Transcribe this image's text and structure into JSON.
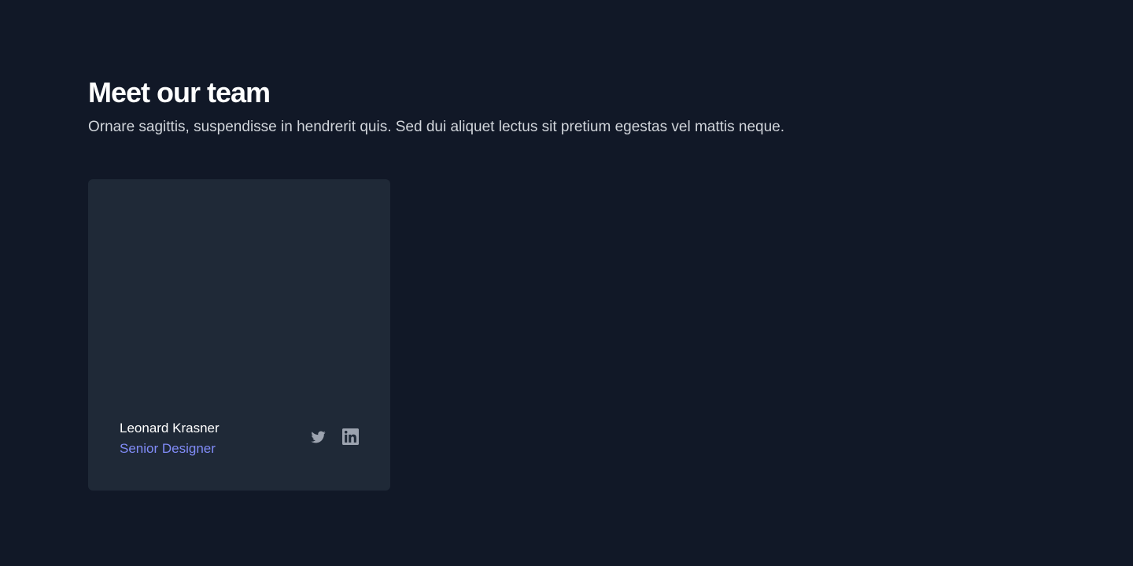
{
  "section": {
    "title": "Meet our team",
    "subtitle": "Ornare sagittis, suspendisse in hendrerit quis. Sed dui aliquet lectus sit pretium egestas vel mattis neque."
  },
  "team": [
    {
      "name": "Leonard Krasner",
      "role": "Senior Designer",
      "socials": [
        "twitter-icon",
        "linkedin-icon"
      ]
    }
  ],
  "colors": {
    "background": "#111827",
    "card": "#1f2937",
    "accent": "#818cf8",
    "icon": "#9ca3af"
  }
}
